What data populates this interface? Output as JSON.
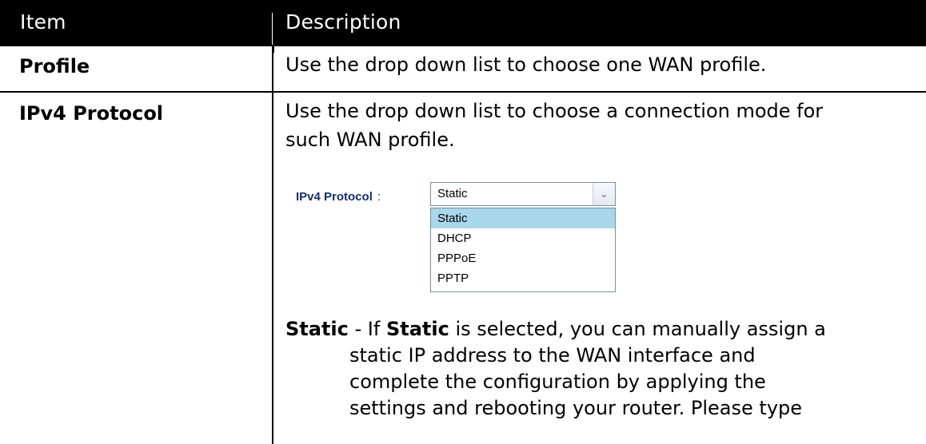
{
  "header": {
    "item": "Item",
    "description": "Description"
  },
  "rows": [
    {
      "item": "Profile",
      "description": "Use the drop down list to choose one WAN profile."
    },
    {
      "item": "IPv4 Protocol",
      "description_line1": "Use the drop down list to choose a connection mode for",
      "description_line2": "such WAN profile."
    }
  ],
  "ipv4_ui": {
    "label": "IPv4 Protocol",
    "colon": ":",
    "selected_value": "Static",
    "options": [
      "Static",
      "DHCP",
      "PPPoE",
      "PPTP"
    ]
  },
  "static_desc": {
    "term": "Static",
    "dash": " - If ",
    "term2": "Static",
    "first_rest": " is selected, you can manually assign a",
    "line2": "static IP address to the WAN interface and",
    "line3": "complete the configuration by applying the",
    "line4": "settings and rebooting your router. Please type"
  }
}
